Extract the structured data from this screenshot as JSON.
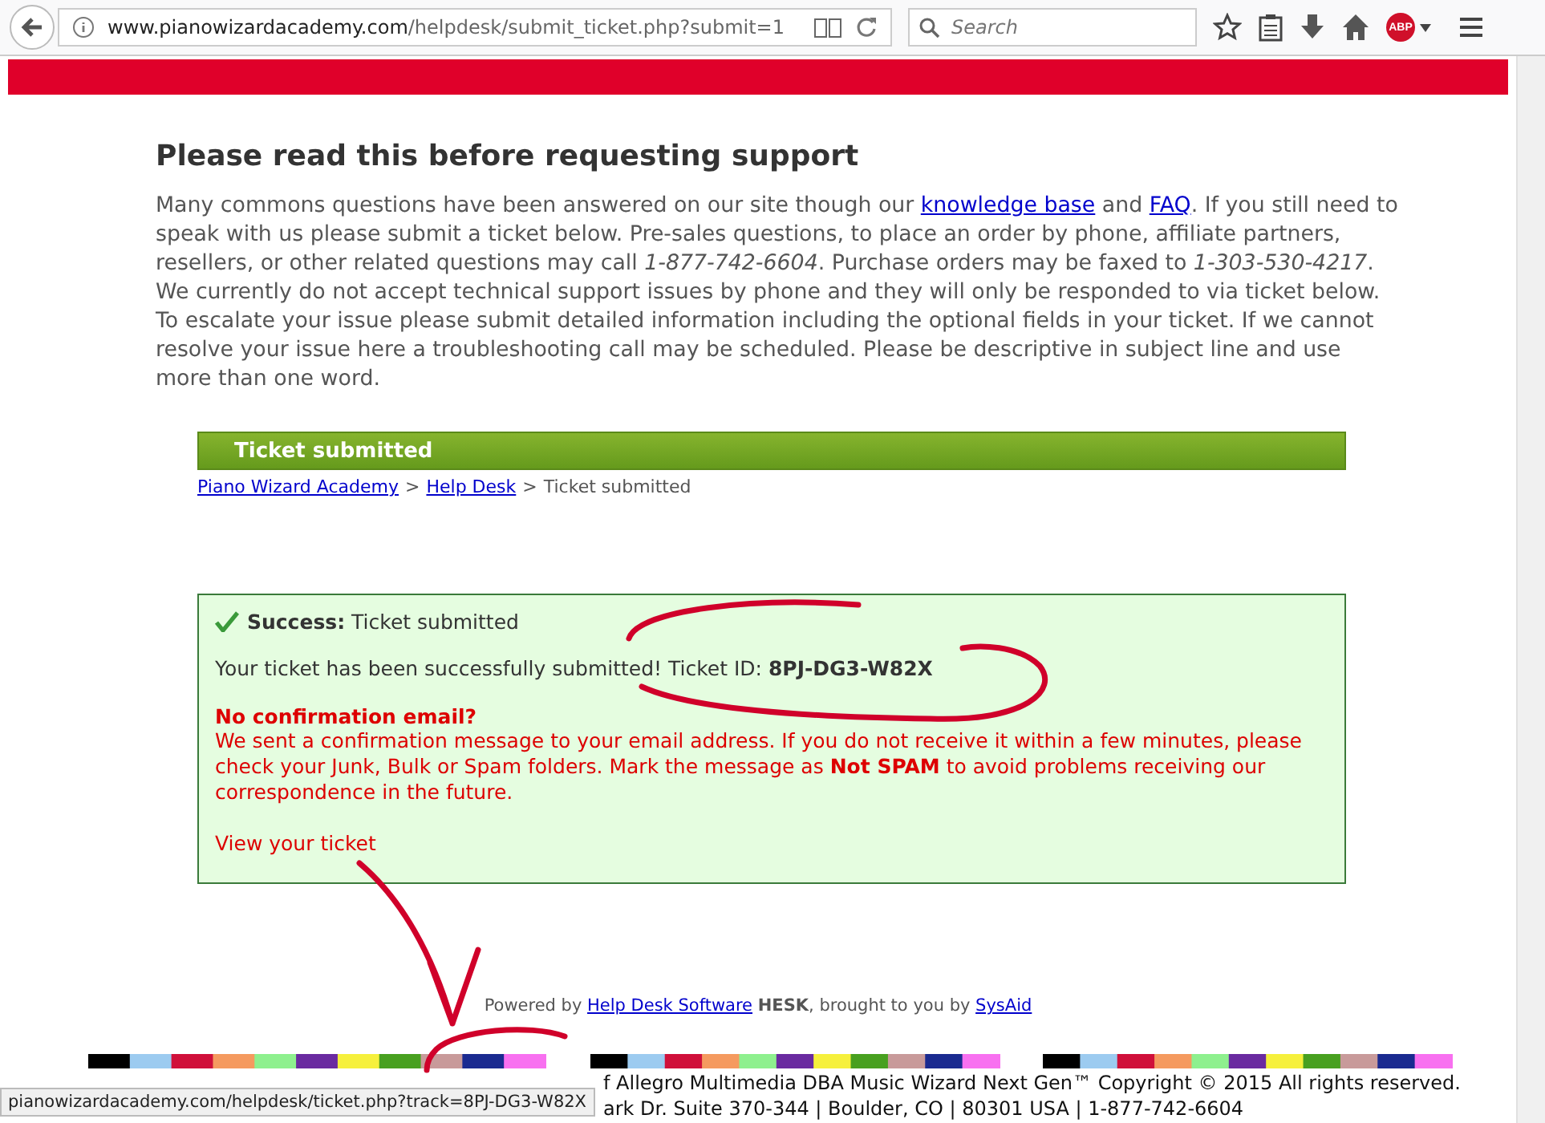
{
  "browser": {
    "url_host": "www.pianowizardacademy.com",
    "url_path": "/helpdesk/submit_ticket.php?submit=1",
    "search_placeholder": "Search",
    "adblock_label": "ABP"
  },
  "heading": "Please read this before requesting support",
  "intro": [
    {
      "kind": "text",
      "text": "Many commons questions have been answered on our site though our "
    },
    {
      "kind": "link",
      "text": "knowledge base"
    },
    {
      "kind": "text",
      "text": " and "
    },
    {
      "kind": "link",
      "text": "FAQ"
    },
    {
      "kind": "text",
      "text": ". If you still need to speak with us please submit a ticket below. Pre-sales questions, to place an order by phone, affiliate partners, resellers, or other related questions may call *1-877-742-6604*. Purchase orders may be faxed to *1-303-530-4217*. We currently do not accept technical support issues by phone and they will only be responded to via ticket below. To escalate your issue please submit detailed information including the optional fields in your ticket. If we cannot resolve your issue here a troubleshooting call may be scheduled. Please be descriptive in subject line and use more than one word."
    }
  ],
  "title_bar": "Ticket submitted",
  "breadcrumb": [
    {
      "kind": "link",
      "text": "Piano Wizard Academy"
    },
    {
      "kind": "sep",
      "text": ">"
    },
    {
      "kind": "link",
      "text": "Help Desk"
    },
    {
      "kind": "sep",
      "text": ">"
    },
    {
      "kind": "text",
      "text": "Ticket submitted"
    }
  ],
  "notice": {
    "title": "**Success:** Ticket submitted",
    "message": "Your ticket has been successfully submitted! Ticket ID: **8PJ-DG3-W82X**",
    "warning_title": "No confirmation email?",
    "warning_text": "We sent a confirmation message to your email address. If you do not receive it within a few minutes, please check your Junk, Bulk or Spam folders. Mark the message as **Not SPAM** to avoid problems receiving our correspondence in the future.",
    "link": "View your ticket"
  },
  "powered_by": [
    {
      "kind": "text",
      "text": "Powered by "
    },
    {
      "kind": "link",
      "text": "Help Desk Software"
    },
    {
      "kind": "text",
      "text": " **HESK**, brought to you by "
    },
    {
      "kind": "link",
      "text": "SysAid"
    }
  ],
  "footer_lines": [
    "f Allegro Multimedia DBA Music Wizard Next Gen™ Copyright © 2015 All rights reserved.",
    "ark Dr. Suite 370-344 | Boulder, CO | 80301 USA | 1-877-742-6604"
  ],
  "status_url": "pianowizardacademy.com/helpdesk/ticket.php?track=8PJ-DG3-W82X"
}
